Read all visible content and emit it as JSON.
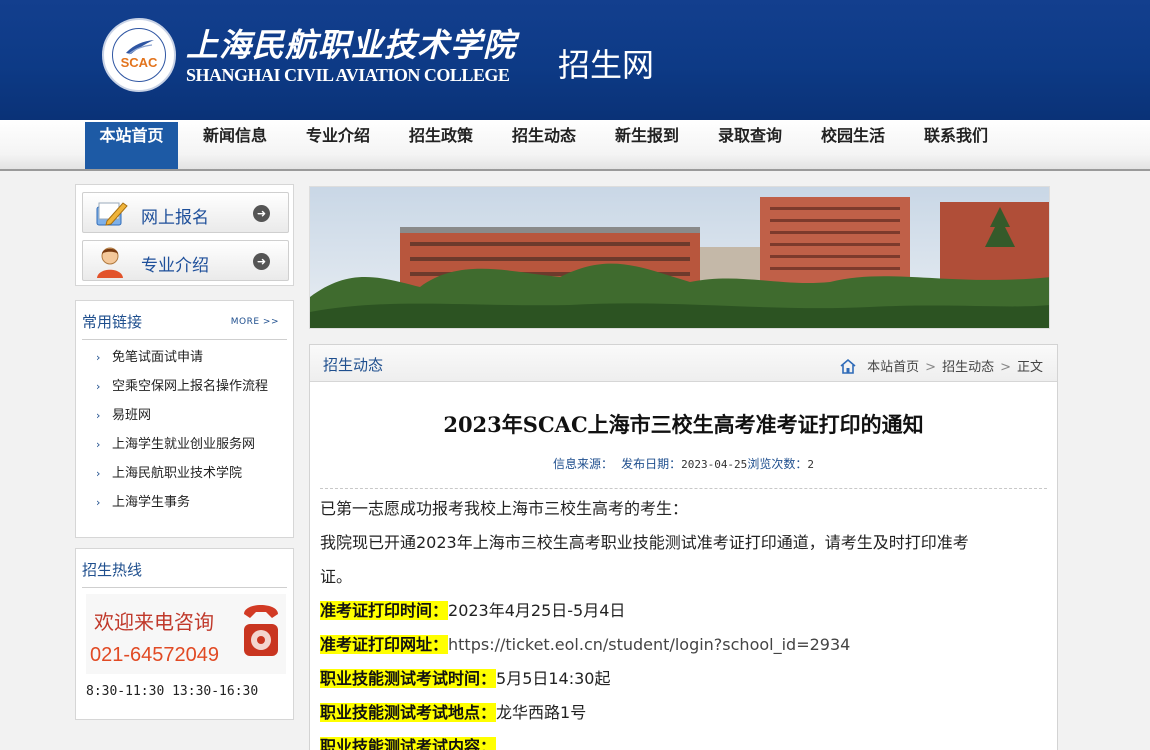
{
  "header": {
    "logo_abbr": "SCAC",
    "college_cn": "上海民航职业技术学院",
    "college_en": "SHANGHAI CIVIL AVIATION COLLEGE",
    "site_name": "招生网"
  },
  "nav": {
    "items": [
      "本站首页",
      "新闻信息",
      "专业介绍",
      "招生政策",
      "招生动态",
      "新生报到",
      "录取查询",
      "校园生活",
      "联系我们"
    ],
    "active_index": 0
  },
  "sidebar": {
    "buttons": [
      {
        "label": "网上报名",
        "icon": "pencil-folder-icon"
      },
      {
        "label": "专业介绍",
        "icon": "person-icon"
      }
    ],
    "links": {
      "title": "常用链接",
      "more": "MORE >>",
      "items": [
        "免笔试面试申请",
        "空乘空保网上报名操作流程",
        "易班网",
        "上海学生就业创业服务网",
        "上海民航职业技术学院",
        "上海学生事务"
      ]
    },
    "hotline": {
      "title": "招生热线",
      "welcome": "欢迎来电咨询",
      "number": "021-64572049",
      "hours": "8:30-11:30 13:30-16:30"
    }
  },
  "article": {
    "category": "招生动态",
    "breadcrumb": [
      "本站首页",
      "招生动态",
      "正文"
    ],
    "title": "2023年SCAC上海市三校生高考准考证打印的通知",
    "meta": {
      "source_label": "信息来源：",
      "date_label": "发布日期：",
      "date": "2023-04-25",
      "views_label": "浏览次数：",
      "views": "2"
    },
    "intro": "已第一志愿成功报考我校上海市三校生高考的考生：",
    "body_line1": "我院现已开通2023年上海市三校生高考职业技能测试准考证打印通道，请考生及时打印准考",
    "body_line2": "证。",
    "fields": [
      {
        "label": "准考证打印时间：",
        "value": "2023年4月25日-5月4日"
      },
      {
        "label": "准考证打印网址：",
        "value": "https://ticket.eol.cn/student/login?school_id=2934"
      },
      {
        "label": "职业技能测试考试时间：",
        "value": "5月5日14:30起"
      },
      {
        "label": "职业技能测试考试地点：",
        "value": "龙华西路1号"
      },
      {
        "label": "职业技能测试考试内容：",
        "value": ""
      }
    ]
  },
  "colors": {
    "header_blue": "#0d3a86",
    "nav_active": "#1d5aa5",
    "link_blue": "#1f4f8e",
    "highlight": "#ffff00",
    "hotline_red": "#e14a24"
  }
}
